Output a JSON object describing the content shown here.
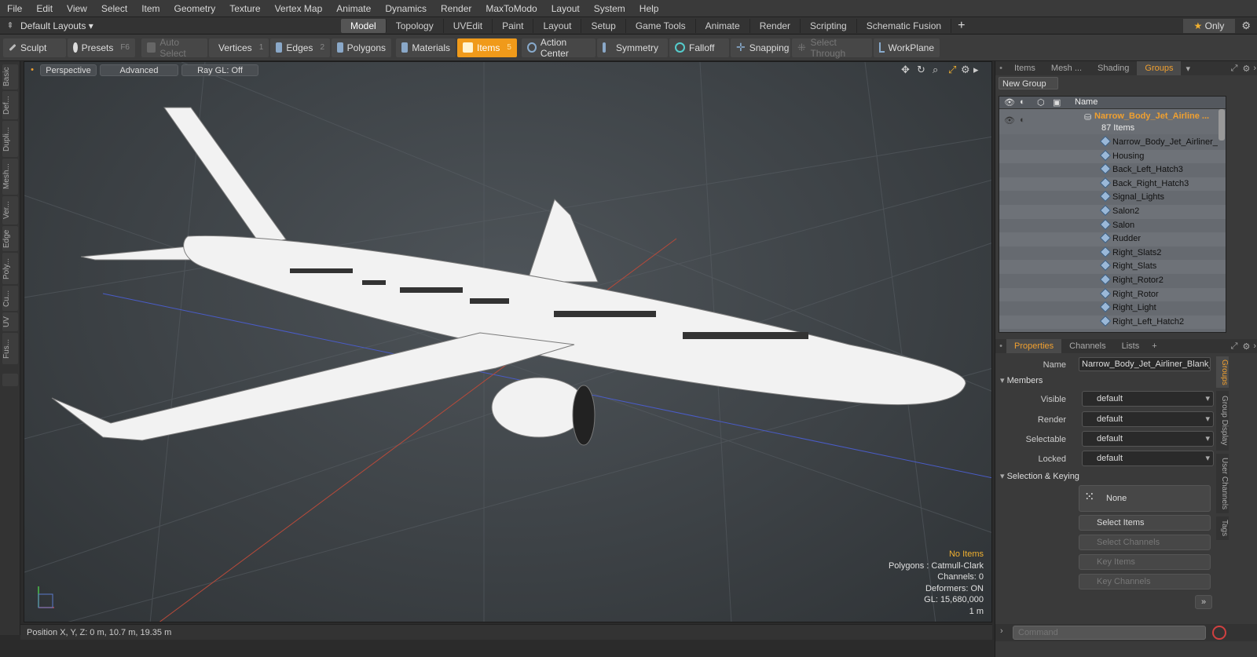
{
  "menubar": [
    "File",
    "Edit",
    "View",
    "Select",
    "Item",
    "Geometry",
    "Texture",
    "Vertex Map",
    "Animate",
    "Dynamics",
    "Render",
    "MaxToModo",
    "Layout",
    "System",
    "Help"
  ],
  "layoutbar": {
    "layout_select": "Default Layouts",
    "tabs": [
      "Model",
      "Topology",
      "UVEdit",
      "Paint",
      "Layout",
      "Setup",
      "Game Tools",
      "Animate",
      "Render",
      "Scripting",
      "Schematic Fusion"
    ],
    "active_tab": "Model",
    "only_label": "Only"
  },
  "toolbar": {
    "sculpt": "Sculpt",
    "presets": "Presets",
    "presets_key": "F6",
    "auto_select": "Auto Select",
    "vertices": "Vertices",
    "vertices_key": "1",
    "edges": "Edges",
    "edges_key": "2",
    "polygons": "Polygons",
    "materials": "Materials",
    "items": "Items",
    "items_key": "5",
    "action_center": "Action Center",
    "symmetry": "Symmetry",
    "falloff": "Falloff",
    "snapping": "Snapping",
    "select_through": "Select Through",
    "workplane": "WorkPlane"
  },
  "left_tabs": [
    "Basic",
    "Def...",
    "Dupli...",
    "Mesh...",
    "Ver...",
    "Edge",
    "Poly...",
    "Cu...",
    "UV",
    "Fus..."
  ],
  "viewport": {
    "view_mode": "Perspective",
    "shading": "Advanced",
    "raygl": "Ray GL: Off",
    "hud": {
      "no_items": "No Items",
      "polygons": "Polygons : Catmull-Clark",
      "channels": "Channels: 0",
      "deformers": "Deformers: ON",
      "gl": "GL: 15,680,000",
      "scale": "1 m"
    }
  },
  "statusbar": {
    "position": "Position X, Y, Z:  0 m, 10.7 m, 19.35 m"
  },
  "groups_panel": {
    "tabs": [
      "Items",
      "Mesh ...",
      "Shading",
      "Groups"
    ],
    "active_tab": "Groups",
    "new_group": "New Group",
    "name_header": "Name",
    "group_name": "Narrow_Body_Jet_Airline ...",
    "group_count": "87 Items",
    "items": [
      "Narrow_Body_Jet_Airliner_ ...",
      "Housing",
      "Back_Left_Hatch3",
      "Back_Right_Hatch3",
      "Signal_Lights",
      "Salon2",
      "Salon",
      "Rudder",
      "Right_Slats2",
      "Right_Slats",
      "Right_Rotor2",
      "Right_Rotor",
      "Right_Light",
      "Right_Left_Hatch2"
    ]
  },
  "properties_panel": {
    "tabs": [
      "Properties",
      "Channels",
      "Lists"
    ],
    "active_tab": "Properties",
    "name_label": "Name",
    "name_value": "Narrow_Body_Jet_Airliner_Blank_",
    "members_section": "Members",
    "visible_label": "Visible",
    "visible_value": "default",
    "render_label": "Render",
    "render_value": "default",
    "selectable_label": "Selectable",
    "selectable_value": "default",
    "locked_label": "Locked",
    "locked_value": "default",
    "selection_section": "Selection & Keying",
    "none_label": "None",
    "select_items": "Select Items",
    "select_channels": "Select Channels",
    "key_items": "Key Items",
    "key_channels": "Key Channels",
    "side_tabs": [
      "Groups",
      "Group Display",
      "User Channels",
      "Tags"
    ]
  },
  "command": {
    "placeholder": "Command"
  },
  "colors": {
    "accent": "#f09a1a",
    "group_name": "#f0a030"
  }
}
